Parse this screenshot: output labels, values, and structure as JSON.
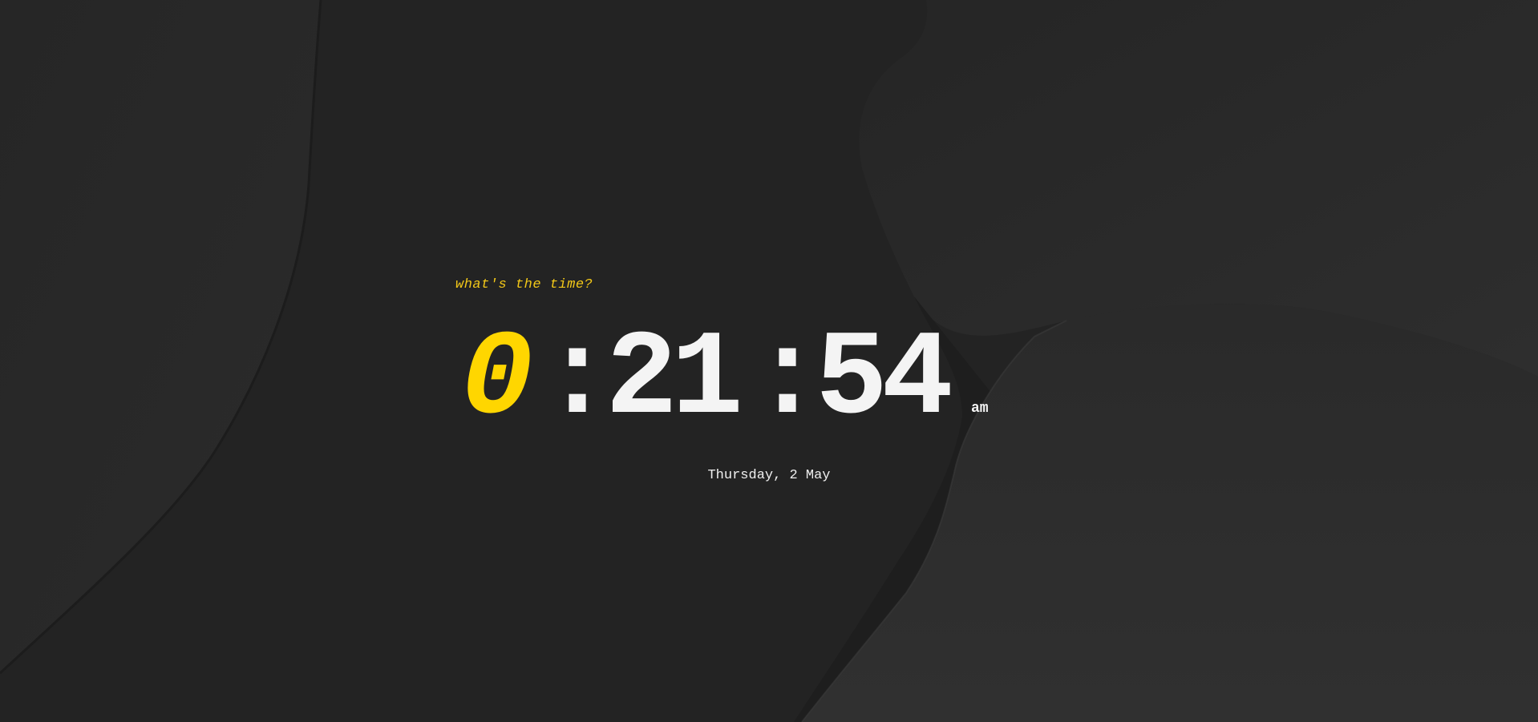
{
  "tagline": "what's the time?",
  "clock": {
    "hours": "0",
    "separator_1": ":",
    "minutes": "21",
    "separator_2": ":",
    "seconds": "54",
    "period": "am"
  },
  "date": "Thursday, 2 May",
  "colors": {
    "background": "#232323",
    "accent": "#ffd600",
    "text": "#f4f4f4"
  }
}
